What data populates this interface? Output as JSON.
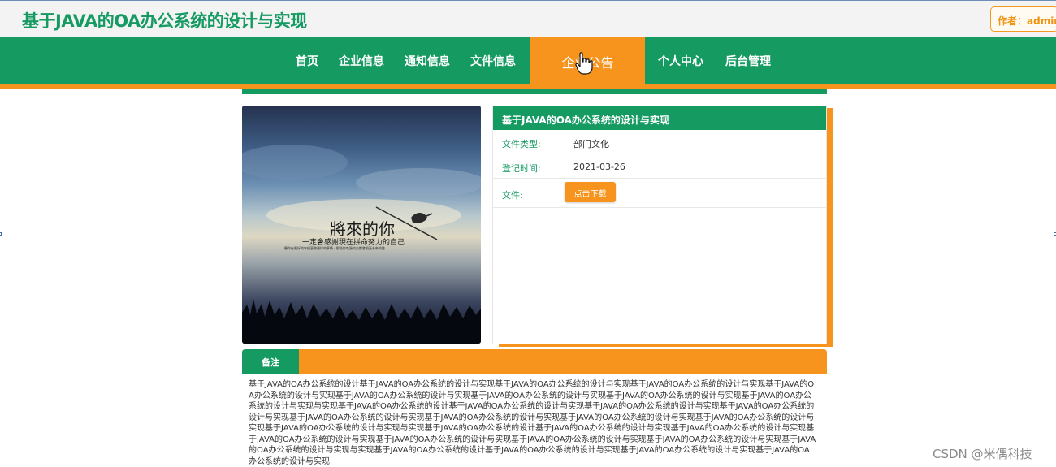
{
  "header": {
    "site_title": "基于JAVA的OA办公系统的设计与实现",
    "author_badge": "作者：admin"
  },
  "nav": {
    "items": [
      {
        "label": "首页"
      },
      {
        "label": "企业信息"
      },
      {
        "label": "通知信息"
      },
      {
        "label": "文件信息"
      },
      {
        "label": "企业公告",
        "active": true
      },
      {
        "label": "个人中心"
      },
      {
        "label": "后台管理"
      }
    ]
  },
  "detail": {
    "image_caption": {
      "main": "將來的你",
      "sub": "一定會感謝現在拼命努力的自己",
      "small": "願你在最好的年紀裏做最好的事情 · 那些你吃過的苦都會照亮未來的路"
    },
    "title": "基于JAVA的OA办公系统的设计与实现",
    "rows": [
      {
        "label": "文件类型:",
        "value": "部门文化"
      },
      {
        "label": "登记时间:",
        "value": "2021-03-26"
      },
      {
        "label": "文件:",
        "value": ""
      }
    ],
    "download_label": "点击下载"
  },
  "remarks": {
    "tab_label": "备注",
    "text": "基于JAVA的OA办公系统的设计基于JAVA的OA办公系统的设计与实现基于JAVA的OA办公系统的设计与实现基于JAVA的OA办公系统的设计与实现基于JAVA的OA办公系统的设计与实现基于JAVA的OA办公系统的设计与实现基于JAVA的OA办公系统的设计与实现基于JAVA的OA办公系统的设计与实现基于JAVA的OA办公系统的设计与实现与实现基于JAVA的OA办公系统的设计基于JAVA的OA办公系统的设计与实现基于JAVA的OA办公系统的设计与实现基于JAVA的OA办公系统的设计与实现基于JAVA的OA办公系统的设计与实现基于JAVA的OA办公系统的设计与实现基于JAVA的OA办公系统的设计与实现基于JAVA的OA办公系统的设计与实现基于JAVA的OA办公系统的设计与实现与实现基于JAVA的OA办公系统的设计基于JAVA的OA办公系统的设计与实现基于JAVA的OA办公系统的设计与实现基于JAVA的OA办公系统的设计与实现基于JAVA的OA办公系统的设计与实现基于JAVA的OA办公系统的设计与实现基于JAVA的OA办公系统的设计与实现基于JAVA的OA办公系统的设计与实现与实现基于JAVA的OA办公系统的设计基于JAVA的OA办公系统的设计与实现基于JAVA的OA办公系统的设计与实现基于JAVA的OA办公系统的设计与实现"
  },
  "watermark": "CSDN @米偶科技",
  "colors": {
    "brand_green": "#159a62",
    "accent_orange": "#f7941d"
  },
  "icons": [
    "hand-pointer-icon"
  ]
}
